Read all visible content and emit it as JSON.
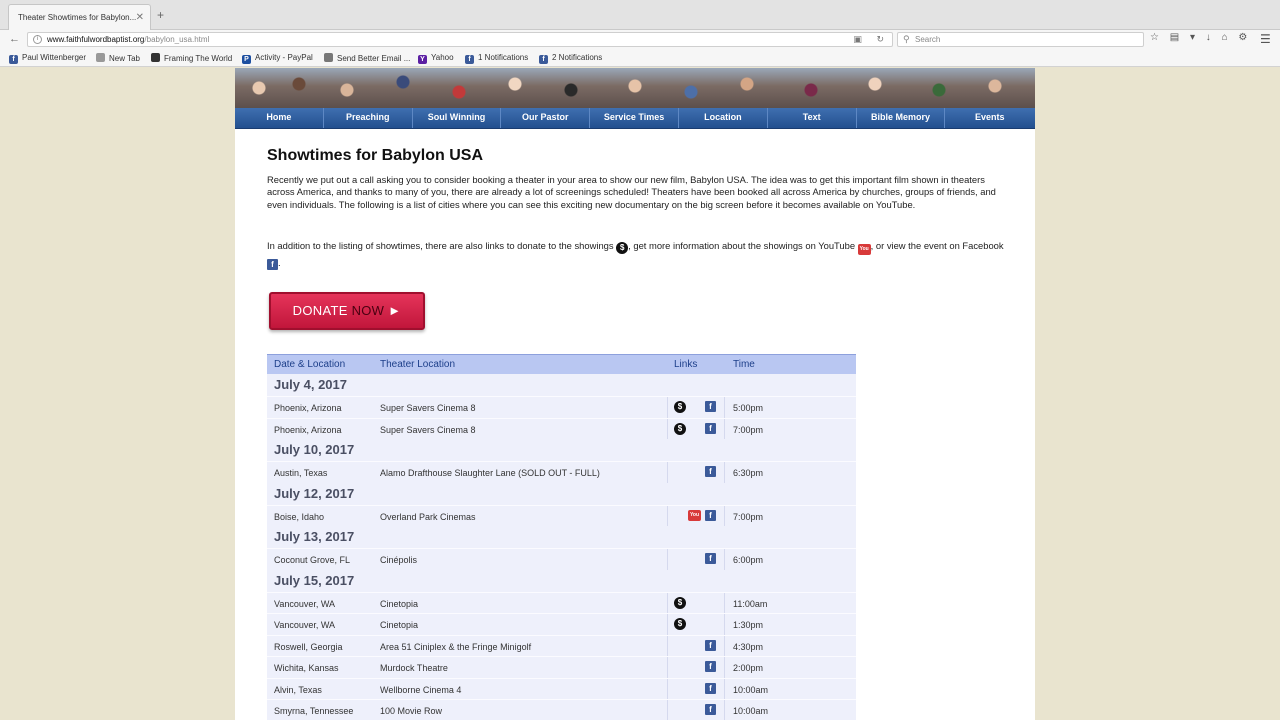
{
  "browser": {
    "tab_title": "Theater Showtimes for Babylon...",
    "url_host": "www.faithfulwordbaptist.org",
    "url_path": "/babylon_usa.html",
    "search_placeholder": "Search"
  },
  "bookmarks": [
    {
      "label": "Paul Wittenberger",
      "icon": "facebook-icon",
      "color": "#3b5a99"
    },
    {
      "label": "New Tab",
      "icon": "globe-icon",
      "color": "#999999"
    },
    {
      "label": "Framing The World",
      "icon": "page-icon",
      "color": "#333333"
    },
    {
      "label": "Activity - PayPal",
      "icon": "paypal-icon",
      "color": "#1d4fa0"
    },
    {
      "label": "Send Better Email ...",
      "icon": "gear-icon",
      "color": "#777777"
    },
    {
      "label": "Yahoo",
      "icon": "yahoo-icon",
      "color": "#5b1fa3"
    },
    {
      "label": "1 Notifications",
      "icon": "facebook-icon",
      "color": "#3b5a99"
    },
    {
      "label": "2 Notifications",
      "icon": "facebook-icon",
      "color": "#3b5a99"
    }
  ],
  "menu": [
    "Home",
    "Preaching",
    "Soul Winning",
    "Our Pastor",
    "Service Times",
    "Location",
    "Text",
    "Bible Memory",
    "Events"
  ],
  "page": {
    "title": "Showtimes for Babylon USA",
    "intro": "Recently we put out a call asking you to consider booking a theater in your area to show our new film, Babylon USA. The idea was to get this important film shown in theaters across America, and thanks to many of you, there are already a lot of screenings scheduled! Theaters have been booked all across America by churches, groups of friends, and even individuals. The following is a list of cities where you can see this exciting new documentary on the big screen before it becomes available on YouTube.",
    "intro2_a": "In addition to the listing of showtimes, there are also links to donate to the showings",
    "intro2_b": ", get more information about the showings on YouTube",
    "intro2_c": ", or view the event on Facebook",
    "intro2_d": ".",
    "donate_a": "DONATE ",
    "donate_b": "NOW",
    "donate_arrow": " ►"
  },
  "table": {
    "headers": {
      "date": "Date & Location",
      "theater": "Theater Location",
      "links": "Links",
      "time": "Time"
    },
    "groups": [
      {
        "date": "July 4, 2017",
        "rows": [
          {
            "city": "Phoenix, Arizona",
            "theater": "Super Savers Cinema 8",
            "donate": true,
            "youtube": false,
            "facebook": true,
            "time": "5:00pm"
          },
          {
            "city": "Phoenix, Arizona",
            "theater": "Super Savers Cinema 8",
            "donate": true,
            "youtube": false,
            "facebook": true,
            "time": "7:00pm"
          }
        ]
      },
      {
        "date": "July 10, 2017",
        "rows": [
          {
            "city": "Austin, Texas",
            "theater": "Alamo Drafthouse Slaughter Lane (SOLD OUT - FULL)",
            "donate": false,
            "youtube": false,
            "facebook": true,
            "time": "6:30pm"
          }
        ]
      },
      {
        "date": "July 12, 2017",
        "rows": [
          {
            "city": "Boise, Idaho",
            "theater": "Overland Park Cinemas",
            "donate": false,
            "youtube": true,
            "facebook": true,
            "time": "7:00pm"
          }
        ]
      },
      {
        "date": "July 13, 2017",
        "rows": [
          {
            "city": "Coconut Grove, FL",
            "theater": "Cinépolis",
            "donate": false,
            "youtube": false,
            "facebook": true,
            "time": "6:00pm"
          }
        ]
      },
      {
        "date": "July 15, 2017",
        "rows": [
          {
            "city": "Vancouver, WA",
            "theater": "Cinetopia",
            "donate": true,
            "youtube": false,
            "facebook": false,
            "time": "11:00am"
          },
          {
            "city": "Vancouver, WA",
            "theater": "Cinetopia",
            "donate": true,
            "youtube": false,
            "facebook": false,
            "time": "1:30pm"
          },
          {
            "city": "Roswell, Georgia",
            "theater": "Area 51 Ciniplex & the Fringe Minigolf",
            "donate": false,
            "youtube": false,
            "facebook": true,
            "time": "4:30pm"
          },
          {
            "city": "Wichita, Kansas",
            "theater": "Murdock Theatre",
            "donate": false,
            "youtube": false,
            "facebook": true,
            "time": "2:00pm"
          },
          {
            "city": "Alvin, Texas",
            "theater": "Wellborne Cinema 4",
            "donate": false,
            "youtube": false,
            "facebook": true,
            "time": "10:00am"
          },
          {
            "city": "Smyrna, Tennessee",
            "theater": "100 Movie Row",
            "donate": false,
            "youtube": false,
            "facebook": true,
            "time": "10:00am"
          }
        ]
      }
    ]
  }
}
